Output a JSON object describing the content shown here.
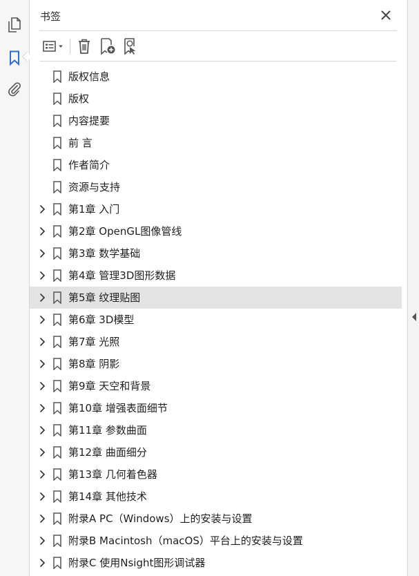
{
  "rail": {
    "icons": [
      "page-thumbnails-icon",
      "bookmarks-icon",
      "attachments-icon"
    ],
    "active": "bookmarks"
  },
  "panel": {
    "title": "书签",
    "close_icon": "close-icon"
  },
  "toolbar": {
    "buttons": [
      "options-icon",
      "delete-bookmark-icon",
      "new-bookmark-icon",
      "find-current-bookmark-icon"
    ]
  },
  "bookmarks": [
    {
      "label": "版权信息",
      "expandable": false
    },
    {
      "label": "版权",
      "expandable": false
    },
    {
      "label": "内容提要",
      "expandable": false
    },
    {
      "label": "前 言",
      "expandable": false
    },
    {
      "label": "作者简介",
      "expandable": false
    },
    {
      "label": "资源与支持",
      "expandable": false
    },
    {
      "label": "第1章 入门",
      "expandable": true
    },
    {
      "label": "第2章 OpenGL图像管线",
      "expandable": true
    },
    {
      "label": "第3章 数学基础",
      "expandable": true
    },
    {
      "label": "第4章 管理3D图形数据",
      "expandable": true
    },
    {
      "label": "第5章 纹理贴图",
      "expandable": true,
      "selected": true
    },
    {
      "label": "第6章 3D模型",
      "expandable": true
    },
    {
      "label": "第7章 光照",
      "expandable": true
    },
    {
      "label": "第8章 阴影",
      "expandable": true
    },
    {
      "label": "第9章 天空和背景",
      "expandable": true
    },
    {
      "label": "第10章 增强表面细节",
      "expandable": true
    },
    {
      "label": "第11章 参数曲面",
      "expandable": true
    },
    {
      "label": "第12章 曲面细分",
      "expandable": true
    },
    {
      "label": "第13章 几何着色器",
      "expandable": true
    },
    {
      "label": "第14章 其他技术",
      "expandable": true
    },
    {
      "label": "附录A PC（Windows）上的安装与设置",
      "expandable": true
    },
    {
      "label": "附录B Macintosh（macOS）平台上的安装与设置",
      "expandable": true
    },
    {
      "label": "附录C 使用Nsight图形调试器",
      "expandable": true
    }
  ],
  "colors": {
    "accent": "#2a6fd6",
    "selected_row": "#e3e3e3",
    "icon_gray": "#5a5a5a"
  }
}
